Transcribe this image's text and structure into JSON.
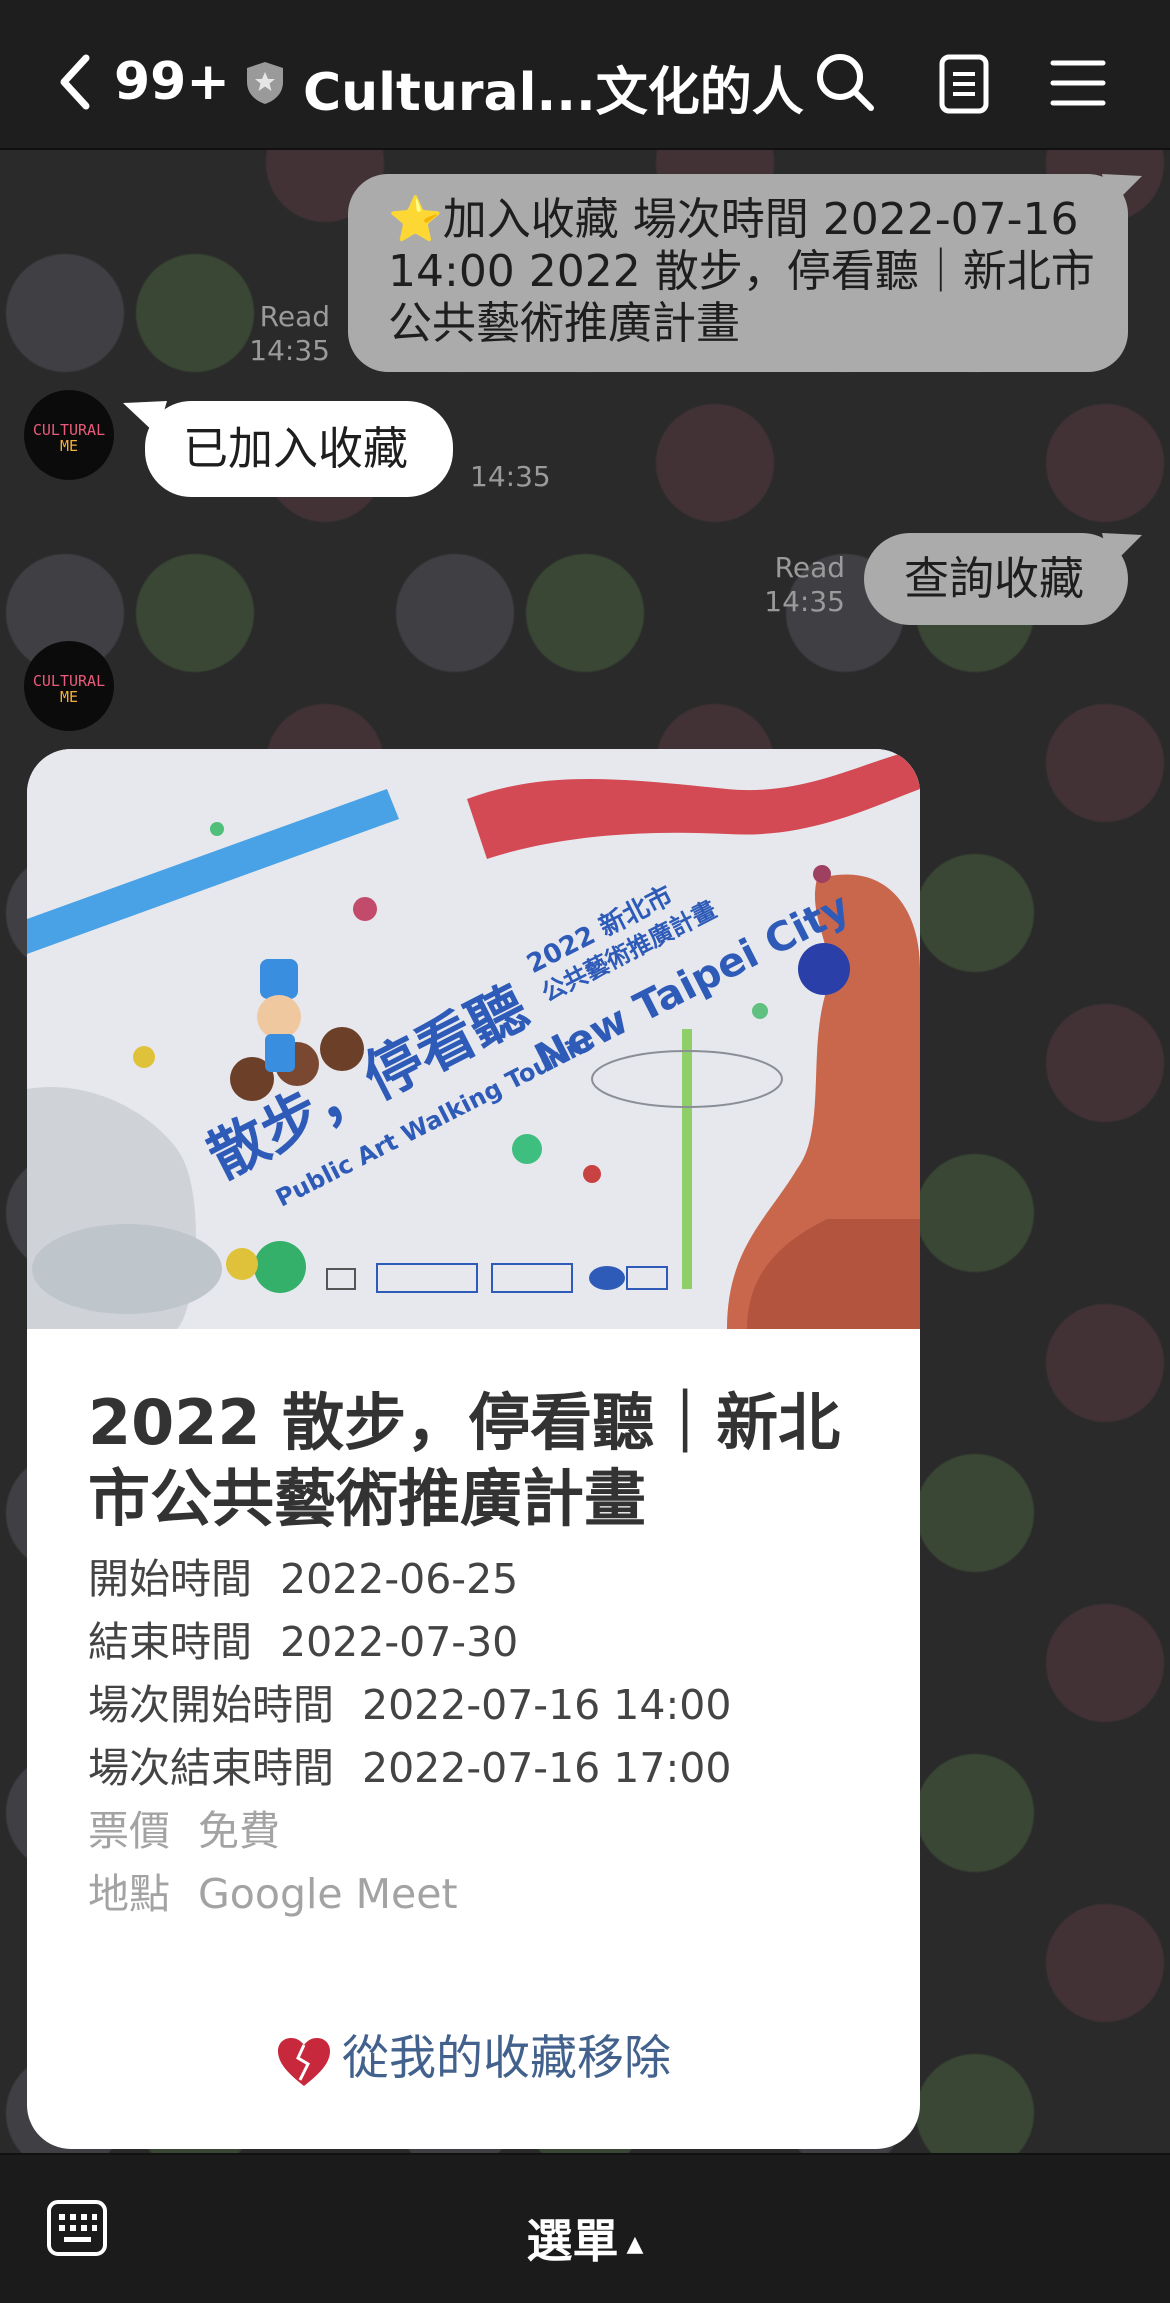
{
  "header": {
    "unread_count": "99+",
    "title": "Cultural...文化的人"
  },
  "messages": [
    {
      "id": "m1",
      "from": "me",
      "text": "⭐加入收藏 場次時間 2022-07-16 14:00 2022 散步，停看聽｜新北市公共藝術推廣計畫",
      "status": "Read",
      "time": "14:35"
    },
    {
      "id": "m2",
      "from": "bot",
      "text": "已加入收藏",
      "time": "14:35"
    },
    {
      "id": "m3",
      "from": "me",
      "text": "查詢收藏",
      "status": "Read",
      "time": "14:35"
    }
  ],
  "avatar_text": [
    "CULTURAL",
    "ME"
  ],
  "card": {
    "poster": {
      "title_cn": "散步，停看聽",
      "year_line": "2022 新北市",
      "subtitle_cn": "公共藝術推廣計畫",
      "title_en": "New Taipei City",
      "subtitle_en": "Public Art Walking Tour in"
    },
    "title": "2022 散步，停看聽｜新北市公共藝術推廣計畫",
    "rows": [
      {
        "label": "開始時間",
        "value": "2022-06-25"
      },
      {
        "label": "結束時間",
        "value": "2022-07-30"
      },
      {
        "label": "場次開始時間",
        "value": "2022-07-16 14:00"
      },
      {
        "label": "場次結束時間",
        "value": "2022-07-16 17:00"
      },
      {
        "label": "票價",
        "value": "免費"
      },
      {
        "label": "地點",
        "value": "Google Meet"
      }
    ],
    "remove_label": "從我的收藏移除"
  },
  "bottom": {
    "menu_label": "選單",
    "caret": "▲"
  },
  "colors": {
    "outgoing_bubble": "#ababab",
    "incoming_bubble": "#ffffff",
    "link_blue": "#42618c",
    "poster_blue": "#2e5bb8"
  }
}
